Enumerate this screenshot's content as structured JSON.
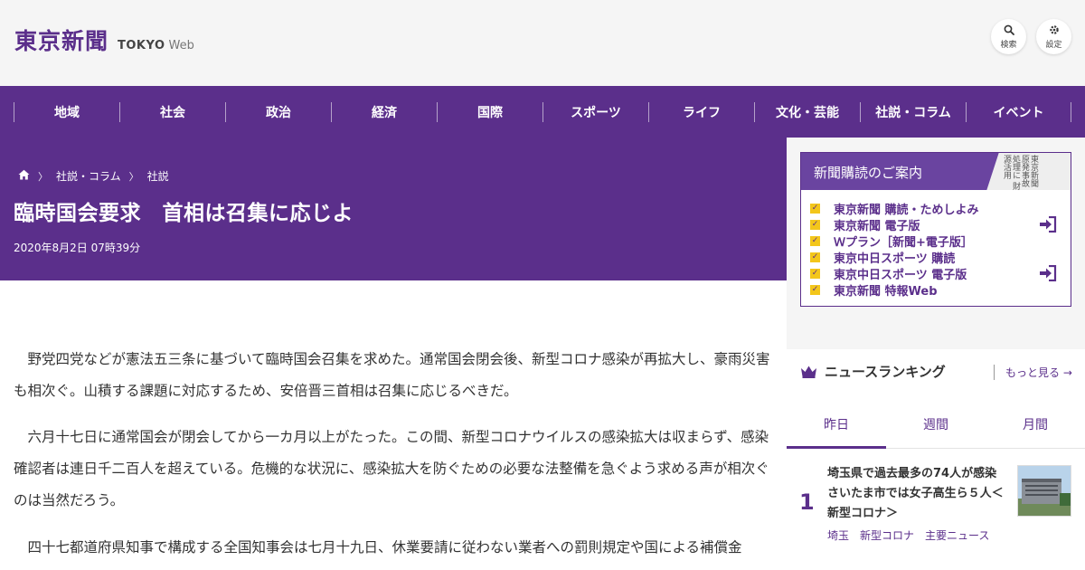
{
  "header": {
    "logo_jp": "東京新聞",
    "logo_tokyo": "TOKYO",
    "logo_web": "Web",
    "search_label": "検索",
    "settings_label": "設定"
  },
  "nav": {
    "items": [
      "地域",
      "社会",
      "政治",
      "経済",
      "国際",
      "スポーツ",
      "ライフ",
      "文化・芸能",
      "社説・コラム",
      "イベント"
    ]
  },
  "article": {
    "breadcrumb": [
      "社説・コラム",
      "社説"
    ],
    "title": "臨時国会要求　首相は召集に応じよ",
    "date": "2020年8月2日 07時39分",
    "paragraphs": [
      "　野党四党などが憲法五三条に基づいて臨時国会召集を求めた。通常国会閉会後、新型コロナ感染が再拡大し、豪雨災害も相次ぐ。山積する課題に対応するため、安倍晋三首相は召集に応じるべきだ。",
      "　六月十七日に通常国会が閉会してから一カ月以上がたった。この間、新型コロナウイルスの感染拡大は収まらず、感染確認者は連日千二百人を超えている。危機的な状況に、感染拡大を防ぐための必要な法整備を急ぐよう求める声が相次ぐのは当然だろう。",
      "　四十七都道府県知事で構成する全国知事会は七月十九日、休業要請に従わない業者への罰則規定や国による補償金"
    ]
  },
  "subscribe": {
    "title": "新聞購読のご案内",
    "paper_text": "東京新聞 原発事故処理に 財源活用",
    "items": [
      "東京新聞 購読・ためしよみ",
      "東京新聞 電子版",
      "Ｗプラン［新聞+電子版］",
      "東京中日スポーツ 購読",
      "東京中日スポーツ 電子版",
      "東京新聞 特報Web"
    ]
  },
  "ranking": {
    "title": "ニュースランキング",
    "more": "もっと見る",
    "tabs": [
      "昨日",
      "週間",
      "月間"
    ],
    "items": [
      {
        "rank": "1",
        "headline": "埼玉県で過去最多の74人が感染　さいたま市では女子高生ら５人＜新型コロナ＞",
        "tags": [
          "埼玉",
          "新型コロナ",
          "主要ニュース"
        ]
      }
    ]
  },
  "colors": {
    "brand_purple": "#5b2f8b",
    "check_yellow": "#f3c61b"
  }
}
